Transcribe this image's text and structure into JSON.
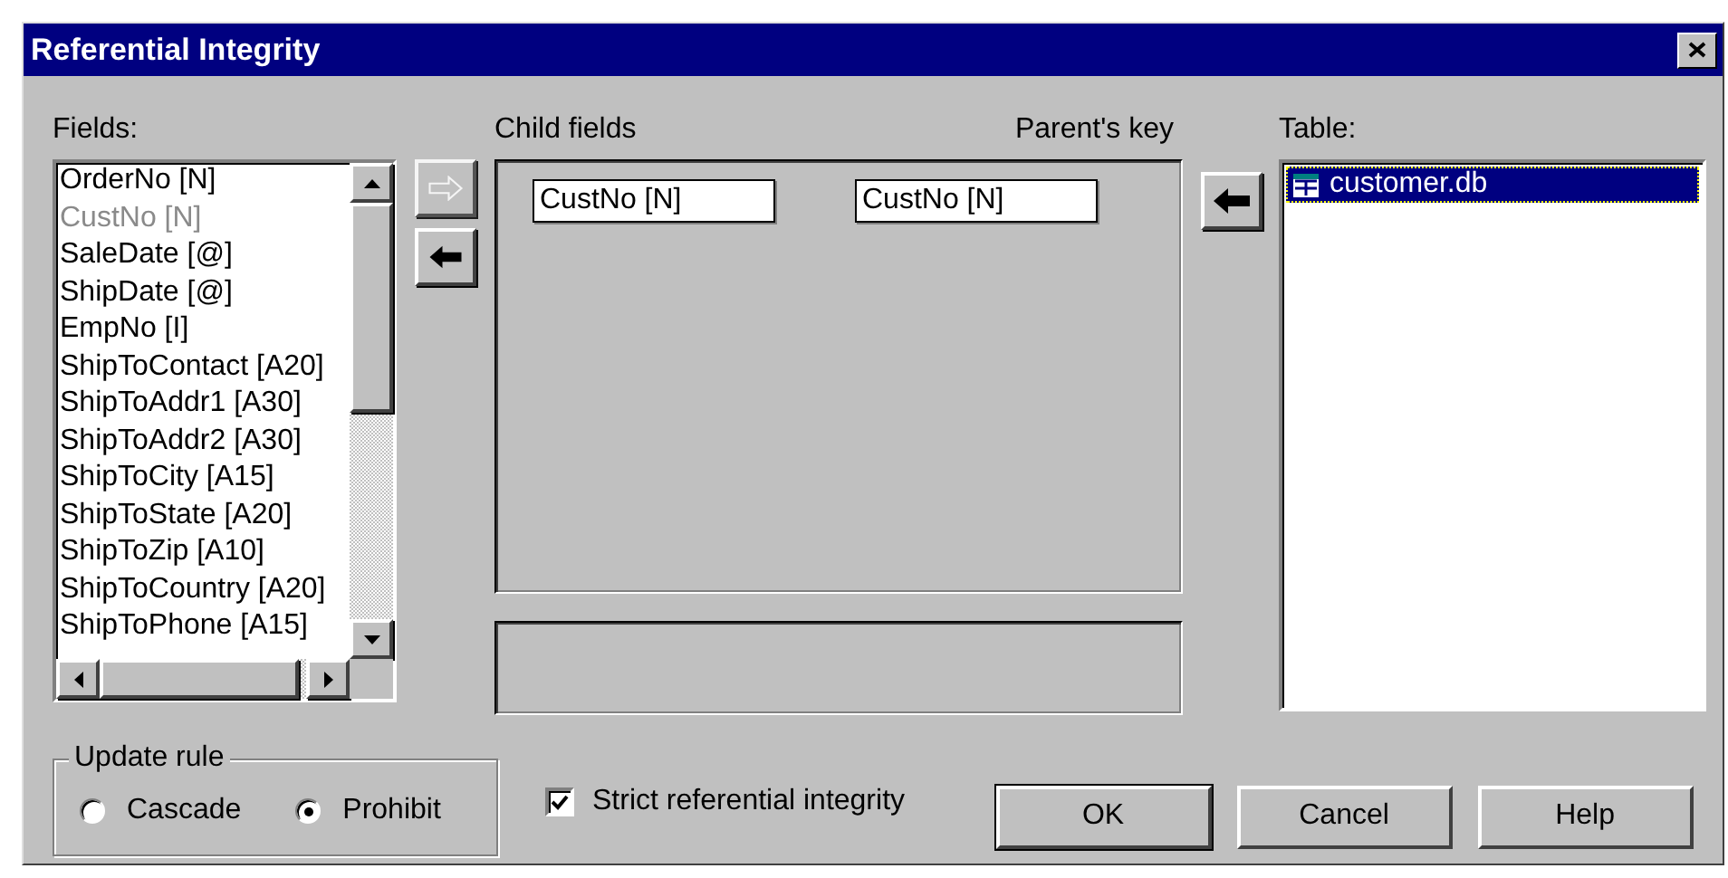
{
  "window": {
    "title": "Referential Integrity"
  },
  "fields": {
    "label": "Fields:",
    "items": [
      {
        "text": "OrderNo [N]",
        "disabled": false
      },
      {
        "text": "CustNo [N]",
        "disabled": true
      },
      {
        "text": "SaleDate [@]",
        "disabled": false
      },
      {
        "text": "ShipDate [@]",
        "disabled": false
      },
      {
        "text": "EmpNo [I]",
        "disabled": false
      },
      {
        "text": "ShipToContact [A20]",
        "disabled": false
      },
      {
        "text": "ShipToAddr1 [A30]",
        "disabled": false
      },
      {
        "text": "ShipToAddr2 [A30]",
        "disabled": false
      },
      {
        "text": "ShipToCity [A15]",
        "disabled": false
      },
      {
        "text": "ShipToState [A20]",
        "disabled": false
      },
      {
        "text": "ShipToZip [A10]",
        "disabled": false
      },
      {
        "text": "ShipToCountry [A20]",
        "disabled": false
      },
      {
        "text": "ShipToPhone [A15]",
        "disabled": false
      }
    ]
  },
  "move_buttons": [
    {
      "kind": "add",
      "disabled": true
    },
    {
      "kind": "remove",
      "disabled": false
    }
  ],
  "child_fields_label": "Child fields",
  "parent_key_label": "Parent's key",
  "key_pairs": [
    {
      "child": "CustNo [N]",
      "parent": "CustNo [N]"
    }
  ],
  "table": {
    "label": "Table:",
    "items": [
      {
        "text": "customer.db",
        "selected": true
      }
    ]
  },
  "update_rule": {
    "label": "Update rule",
    "options": [
      {
        "label": "Cascade",
        "selected": false
      },
      {
        "label": "Prohibit",
        "selected": true
      }
    ]
  },
  "strict": {
    "label": "Strict referential integrity",
    "checked": true
  },
  "buttons": [
    {
      "label": "OK",
      "default": true
    },
    {
      "label": "Cancel",
      "default": false
    },
    {
      "label": "Help",
      "default": false
    }
  ]
}
